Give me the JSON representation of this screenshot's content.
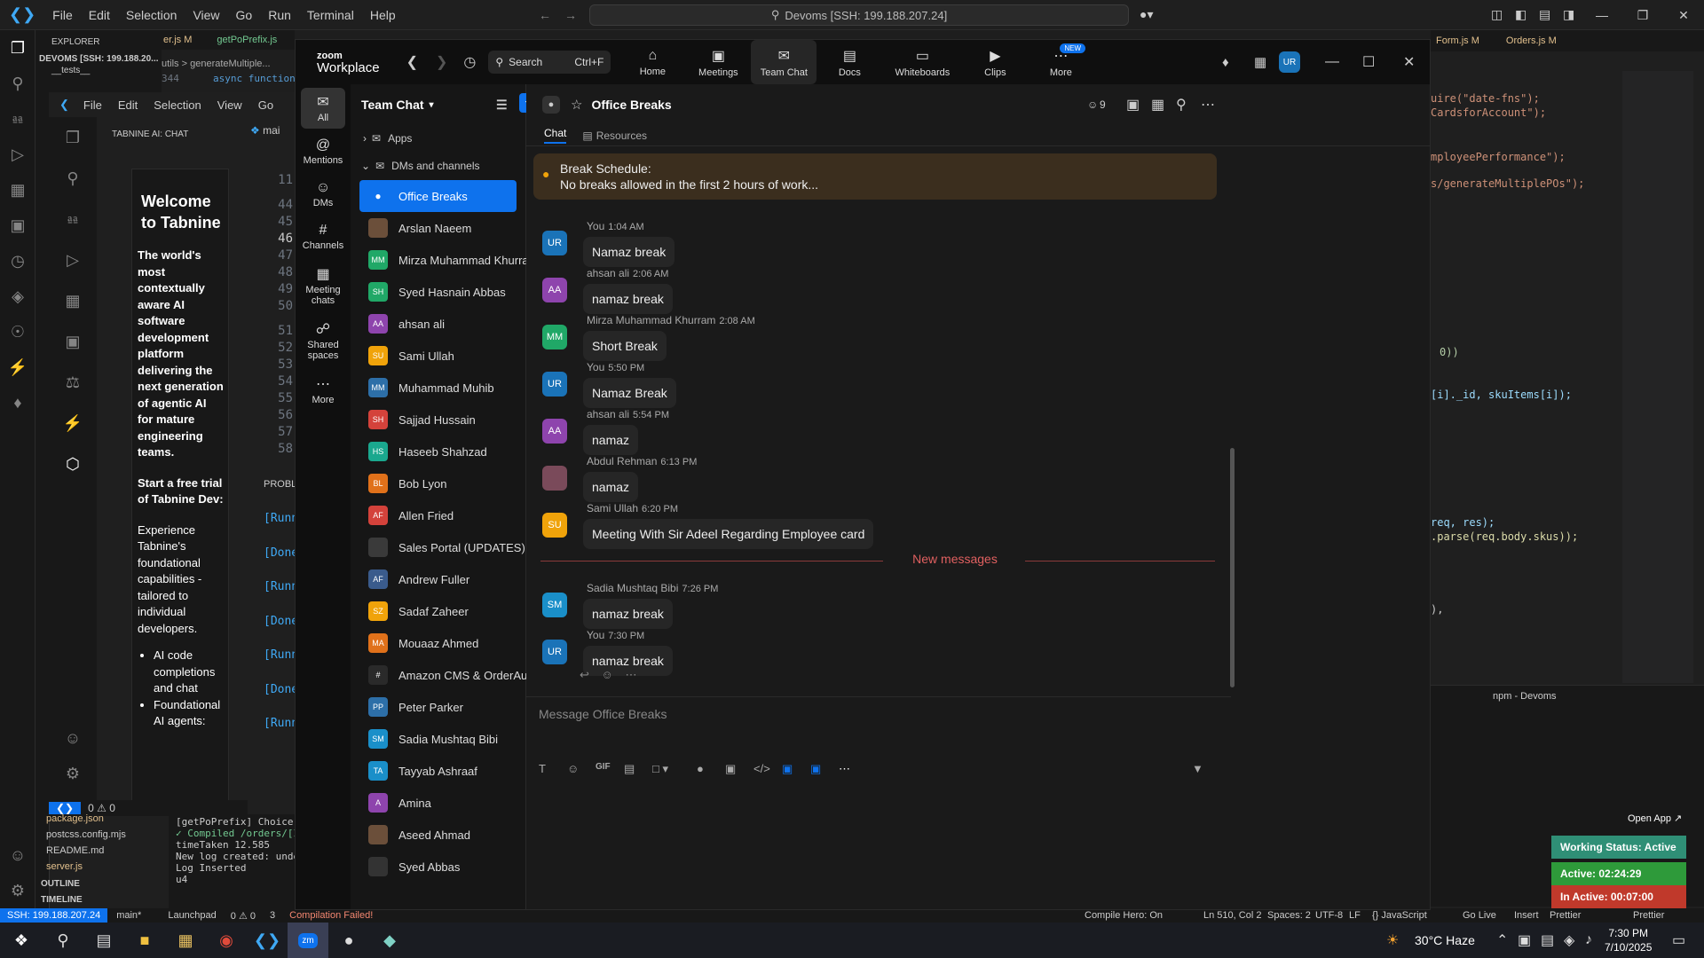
{
  "vscode": {
    "menu": [
      "File",
      "Edit",
      "Selection",
      "View",
      "Go",
      "Run",
      "Terminal",
      "Help"
    ],
    "search": "Devoms [SSH: 199.188.207.24]",
    "explorer_title": "EXPLORER",
    "explorer_root": "DEVOMS [SSH: 199.188.20...",
    "explorer_tests": "__tests__",
    "tabs_left": [
      "er.js M",
      "getPoPrefix.js"
    ],
    "crumb": "utils > generateMultiple...",
    "line_344": "344",
    "code_344": "async function",
    "inner_menu": [
      "File",
      "Edit",
      "Selection",
      "View",
      "Go"
    ],
    "tabnine_title": "TABNINE AI: CHAT",
    "tabnine_tab": "mai",
    "tabnine_heading": "Welcome to Tabnine",
    "tabnine_p1": "The world's most contextually aware AI software development platform delivering the next generation of agentic AI for mature engineering teams.",
    "tabnine_p2": "Start a free trial of Tabnine Dev:",
    "tabnine_p3": "Experience Tabnine's foundational capabilities - tailored to individual developers.",
    "tabnine_li1": "AI code completions and chat",
    "tabnine_li2": "Foundational AI agents:",
    "line_numbers": [
      "11",
      "44",
      "45",
      "46",
      "47",
      "48",
      "49",
      "50",
      "51",
      "52",
      "53",
      "54",
      "55",
      "56",
      "57",
      "58"
    ],
    "problems": "PROBLI",
    "run_lines": [
      "[Runn",
      "[Done",
      "[Runn",
      "[Done",
      "[Runn",
      "[Done",
      "[Runn"
    ],
    "files": [
      "package.json",
      "postcss.config.mjs",
      "README.md",
      "server.js"
    ],
    "outline": "OUTLINE",
    "timeline": "TIMELINE",
    "term_lines": [
      "[getPoPrefix] Choice a",
      "✓ Compiled /orders/[I",
      "timeTaken 12.585",
      "New log created:  unde",
      "Log Inserted",
      "u4"
    ],
    "right_tabs": [
      "Form.js M",
      "Orders.js M"
    ],
    "right_code": [
      "uire(\"date-fns\");",
      "CardsforAccount\");",
      "mployeePerformance\");",
      "s/generateMultiplePOs\");",
      "0))",
      "[i]._id, skuItems[i]);",
      "req, res);",
      ".parse(req.body.skus));",
      "),"
    ],
    "terminal_title": "npm - Devoms",
    "status_left": [
      "SSH: 199.188.207.24",
      "main*",
      "Launchpad",
      "0 ⚠ 0",
      "3",
      "Compilation Failed!"
    ],
    "status_right": [
      "Compile Hero: On",
      "Ln 510, Col 2",
      "Spaces: 2",
      "UTF-8",
      "LF",
      "{} JavaScript",
      "Go Live",
      "Insert",
      "Prettier",
      "Prettier"
    ],
    "errors": "0 ⚠ 0"
  },
  "zoom": {
    "logo_top": "zoom",
    "logo_bottom": "Workplace",
    "search_label": "Search",
    "search_shortcut": "Ctrl+F",
    "nav": [
      {
        "label": "Home",
        "icon": "home-icon"
      },
      {
        "label": "Meetings",
        "icon": "video-icon"
      },
      {
        "label": "Team Chat",
        "icon": "chat-icon"
      },
      {
        "label": "Docs",
        "icon": "doc-icon"
      },
      {
        "label": "Whiteboards",
        "icon": "whiteboard-icon"
      },
      {
        "label": "Clips",
        "icon": "clips-icon"
      },
      {
        "label": "More",
        "icon": "more-icon"
      }
    ],
    "new_badge": "NEW",
    "user_initials": "UR",
    "side": [
      "All",
      "Mentions",
      "DMs",
      "Channels",
      "Meeting chats",
      "Shared spaces",
      "More"
    ],
    "list_title": "Team Chat",
    "apps": "Apps",
    "dms_channels": "DMs and channels",
    "channels": [
      {
        "name": "Office Breaks",
        "initials": "",
        "color": "#0e72ed",
        "active": true
      },
      {
        "name": "Arslan Naeem",
        "initials": "",
        "color": "#6b4f3a"
      },
      {
        "name": "Mirza Muhammad Khurram",
        "initials": "MM",
        "color": "#20a867"
      },
      {
        "name": "Syed Hasnain Abbas",
        "initials": "SH",
        "color": "#20a867"
      },
      {
        "name": "ahsan ali",
        "initials": "AA",
        "color": "#8e44ad"
      },
      {
        "name": "Sami Ullah",
        "initials": "SU",
        "color": "#f0a30a"
      },
      {
        "name": "Muhammad Muhib",
        "initials": "MM",
        "color": "#2d6fa8"
      },
      {
        "name": "Sajjad Hussain",
        "initials": "SH",
        "color": "#d4423b"
      },
      {
        "name": "Haseeb Shahzad",
        "initials": "HS",
        "color": "#1aa88e"
      },
      {
        "name": "Bob Lyon",
        "initials": "BL",
        "color": "#e0711a"
      },
      {
        "name": "Allen Fried",
        "initials": "AF",
        "color": "#d4423b"
      },
      {
        "name": "Sales Portal (UPDATES)",
        "initials": "",
        "color": "#3a3a3a"
      },
      {
        "name": "Andrew Fuller",
        "initials": "AF",
        "color": "#3a5b8c"
      },
      {
        "name": "Sadaf Zaheer",
        "initials": "SZ",
        "color": "#f0a30a"
      },
      {
        "name": "Mouaaz Ahmed",
        "initials": "MA",
        "color": "#e0711a"
      },
      {
        "name": "Amazon CMS & OrderAuto...",
        "initials": "#",
        "color": "#2a2a2a"
      },
      {
        "name": "Peter Parker",
        "initials": "PP",
        "color": "#2d6fa8"
      },
      {
        "name": "Sadia Mushtaq Bibi",
        "initials": "SM",
        "color": "#1a8fc9"
      },
      {
        "name": "Tayyab Ashraaf",
        "initials": "TA",
        "color": "#1a8fc9"
      },
      {
        "name": "Amina",
        "initials": "A",
        "color": "#8e44ad"
      },
      {
        "name": "Aseed Ahmad",
        "initials": "",
        "color": "#6b4f3a"
      },
      {
        "name": "Syed Abbas",
        "initials": "",
        "color": "#333"
      }
    ],
    "chat_title": "Office Breaks",
    "member_count": "9",
    "tabs": [
      "Chat",
      "Resources"
    ],
    "pinned_title": "Break Schedule:",
    "pinned_text": "No breaks allowed in the first 2 hours of work...",
    "messages": [
      {
        "sender": "You",
        "time": "1:04 AM",
        "initials": "UR",
        "color": "#1a73b8",
        "text": "Namaz break"
      },
      {
        "sender": "ahsan ali",
        "time": "2:06 AM",
        "initials": "AA",
        "color": "#8e44ad",
        "text": "namaz break"
      },
      {
        "sender": "Mirza Muhammad Khurram",
        "time": "2:08 AM",
        "initials": "MM",
        "color": "#20a867",
        "text": "Short Break"
      },
      {
        "sender": "You",
        "time": "5:50 PM",
        "initials": "UR",
        "color": "#1a73b8",
        "text": "Namaz Break"
      },
      {
        "sender": "ahsan ali",
        "time": "5:54 PM",
        "initials": "AA",
        "color": "#8e44ad",
        "text": "namaz"
      },
      {
        "sender": "Abdul Rehman",
        "time": "6:13 PM",
        "initials": "",
        "color": "#7a4a5a",
        "text": "namaz"
      },
      {
        "sender": "Sami Ullah",
        "time": "6:20 PM",
        "initials": "SU",
        "color": "#f0a30a",
        "text": "Meeting With Sir Adeel Regarding Employee card"
      },
      {
        "sender": "Sadia Mushtaq Bibi",
        "time": "7:26 PM",
        "initials": "SM",
        "color": "#1a8fc9",
        "text": "namaz break"
      },
      {
        "sender": "You",
        "time": "7:30 PM",
        "initials": "UR",
        "color": "#1a73b8",
        "text": "namaz break"
      }
    ],
    "new_messages": "New messages",
    "composer_placeholder": "Message Office Breaks"
  },
  "status_widget": {
    "open_app": "Open App ↗",
    "working": "Working Status: Active",
    "active": "Active: 02:24:29",
    "inactive": "In Active: 00:07:00"
  },
  "taskbar": {
    "weather": "30°C  Haze",
    "time": "7:30 PM",
    "date": "7/10/2025",
    "tray_lang": "⌃"
  }
}
